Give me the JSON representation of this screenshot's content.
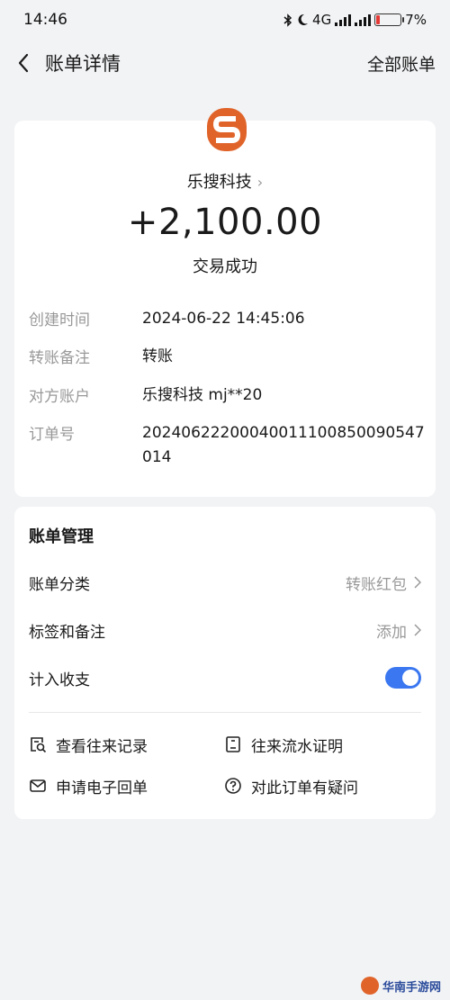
{
  "status_bar": {
    "time": "14:46",
    "network": "4G",
    "battery": "7%"
  },
  "nav": {
    "title": "账单详情",
    "right_link": "全部账单"
  },
  "merchant": {
    "name": "乐搜科技",
    "chevron": "›",
    "logo_icon": "leso-logo-icon"
  },
  "transaction": {
    "amount": "+2,100.00",
    "status": "交易成功"
  },
  "details": [
    {
      "key": "创建时间",
      "value": "2024-06-22 14:45:06"
    },
    {
      "key": "转账备注",
      "value": "转账"
    },
    {
      "key": "对方账户",
      "value": "乐搜科技 mj**20"
    },
    {
      "key": "订单号",
      "value": "20240622200040011100850090547014"
    }
  ],
  "management": {
    "title": "账单管理",
    "category_label": "账单分类",
    "category_value": "转账红包",
    "tags_label": "标签和备注",
    "tags_value": "添加",
    "income_label": "计入收支",
    "income_enabled": true
  },
  "actions": {
    "history": "查看往来记录",
    "proof": "往来流水证明",
    "receipt": "申请电子回单",
    "question": "对此订单有疑问"
  },
  "watermark": {
    "text": "华南手游网"
  },
  "colors": {
    "accent": "#3a77f0",
    "logo_orange": "#e0642a",
    "muted": "#999999",
    "background": "#f2f3f5"
  }
}
